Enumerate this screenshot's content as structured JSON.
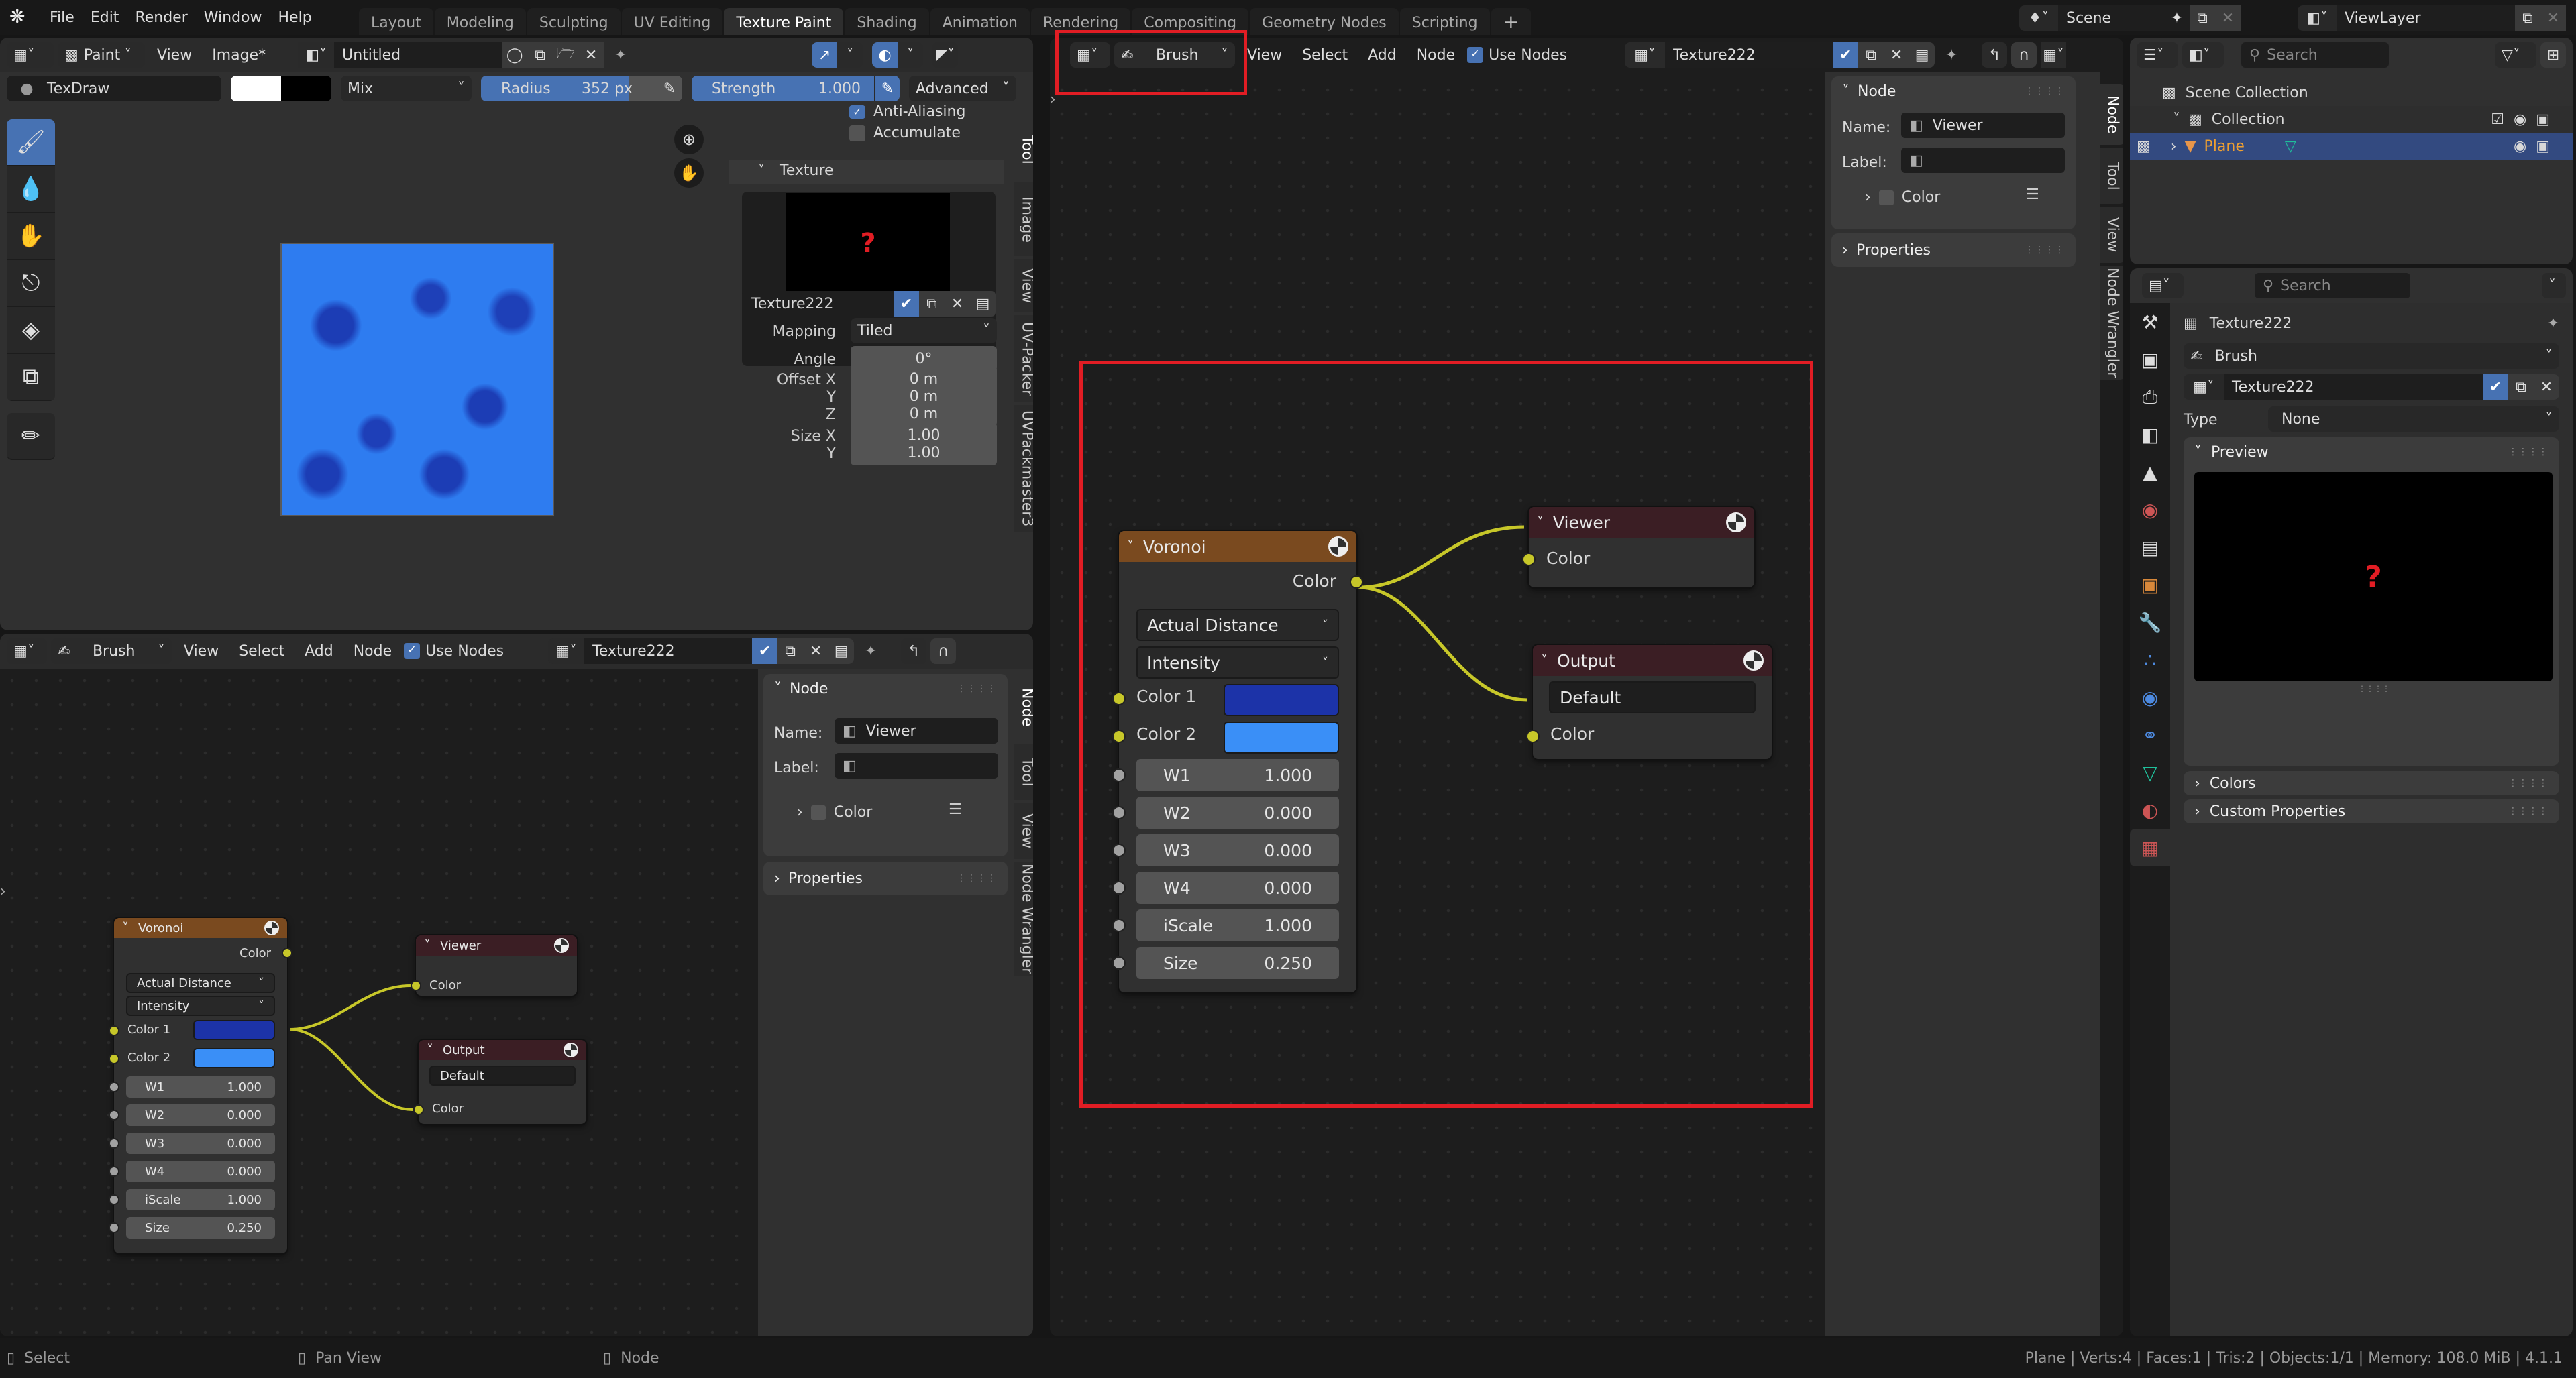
{
  "app": {
    "logo": "blender-logo"
  },
  "top_menu": [
    "File",
    "Edit",
    "Render",
    "Window",
    "Help"
  ],
  "workspace_tabs": [
    {
      "label": "Layout",
      "active": false
    },
    {
      "label": "Modeling",
      "active": false
    },
    {
      "label": "Sculpting",
      "active": false
    },
    {
      "label": "UV Editing",
      "active": false
    },
    {
      "label": "Texture Paint",
      "active": true
    },
    {
      "label": "Shading",
      "active": false
    },
    {
      "label": "Animation",
      "active": false
    },
    {
      "label": "Rendering",
      "active": false
    },
    {
      "label": "Compositing",
      "active": false
    },
    {
      "label": "Geometry Nodes",
      "active": false
    },
    {
      "label": "Scripting",
      "active": false
    }
  ],
  "add_workspace": "+",
  "scene": {
    "label": "Scene",
    "view_layer": "ViewLayer"
  },
  "image_editor": {
    "mode": "Paint",
    "menus": [
      "View",
      "Image*"
    ],
    "image_name": "Untitled",
    "brush_name": "TexDraw",
    "blend_mode": "Mix",
    "radius_label": "Radius",
    "radius_value": "352 px",
    "strength_label": "Strength",
    "strength_value": "1.000",
    "advanced": "Advanced",
    "colors": {
      "primary": "#ffffff",
      "secondary": "#000000"
    },
    "tools": [
      "paint-brush-icon",
      "soften-icon",
      "smear-icon",
      "clone-stamp-icon",
      "fill-icon",
      "mask-icon",
      "annotate-icon"
    ],
    "sidebar": {
      "anti_aliasing": "Anti-Aliasing",
      "anti_aliasing_checked": true,
      "accumulate": "Accumulate",
      "accumulate_checked": false,
      "texture_panel": "Texture",
      "texture_name": "Texture222",
      "mapping_label": "Mapping",
      "mapping_value": "Tiled",
      "angle_label": "Angle",
      "angle_value": "0°",
      "offset_x_label": "Offset X",
      "offset_x": "0 m",
      "offset_y_label": "Y",
      "offset_y": "0 m",
      "offset_z_label": "Z",
      "offset_z": "0 m",
      "size_x_label": "Size X",
      "size_x": "1.00",
      "size_y_label": "Y",
      "size_y": "1.00"
    },
    "side_tabs": [
      "Tool",
      "Image",
      "View",
      "UV-Packer",
      "UVPackmaster3"
    ]
  },
  "node_editor": {
    "tree_type": "Brush",
    "menus": [
      "View",
      "Select",
      "Add",
      "Node"
    ],
    "use_nodes_label": "Use Nodes",
    "use_nodes": true,
    "texture_name": "Texture222",
    "sidebar": {
      "node_panel": "Node",
      "name_label": "Name:",
      "name_value": "Viewer",
      "label_label": "Label:",
      "label_value": "",
      "color_label": "Color",
      "properties_panel": "Properties"
    },
    "side_tabs": [
      "Node",
      "Tool",
      "View",
      "Node Wrangler"
    ],
    "nodes": {
      "voronoi": {
        "title": "Voronoi",
        "header_color": "#7a4a1f",
        "output": "Color",
        "distance_metric": "Actual Distance",
        "coloring": "Intensity",
        "color1_label": "Color 1",
        "color1": "#1c33a8",
        "color2_label": "Color 2",
        "color2": "#3a8ff7",
        "inputs": [
          {
            "label": "W1",
            "value": "1.000"
          },
          {
            "label": "W2",
            "value": "0.000"
          },
          {
            "label": "W3",
            "value": "0.000"
          },
          {
            "label": "W4",
            "value": "0.000"
          },
          {
            "label": "iScale",
            "value": "1.000"
          },
          {
            "label": "Size",
            "value": "0.250"
          }
        ]
      },
      "viewer": {
        "title": "Viewer",
        "header_color": "#3b1e24",
        "input": "Color"
      },
      "output": {
        "title": "Output",
        "header_color": "#3b1e24",
        "name_value": "Default",
        "input": "Color"
      }
    },
    "link_color": "#c7c729"
  },
  "outliner": {
    "search_placeholder": "Search",
    "items": [
      {
        "label": "Scene Collection",
        "level": 0
      },
      {
        "label": "Collection",
        "level": 1
      },
      {
        "label": "Plane",
        "level": 2,
        "selected": true
      }
    ]
  },
  "properties": {
    "search_placeholder": "Search",
    "texture_title": "Texture222",
    "context": "Brush",
    "texture_name": "Texture222",
    "type_label": "Type",
    "type_value": "None",
    "preview_panel": "Preview",
    "colors_panel": "Colors",
    "custom_props_panel": "Custom Properties",
    "tabs": [
      "tool-icon",
      "render-icon",
      "output-icon",
      "view-layer-icon",
      "scene-icon",
      "world-icon",
      "collection-icon",
      "object-icon",
      "modifier-icon",
      "particles-icon",
      "physics-icon",
      "constraints-icon",
      "data-icon",
      "material-icon",
      "texture-icon"
    ]
  },
  "status_bar": {
    "select": "Select",
    "pan_view": "Pan View",
    "node": "Node",
    "stats": "Plane | Verts:4 | Faces:1 | Tris:2 | Objects:1/1 | Memory: 108.0 MiB | 4.1.1"
  },
  "highlight_color": "#e11d24"
}
